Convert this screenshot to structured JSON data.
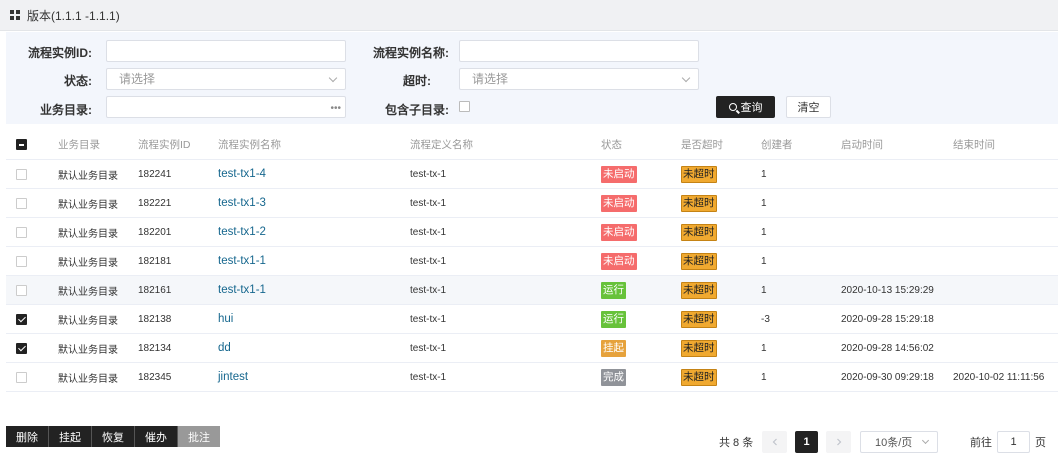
{
  "title": "版本(1.1.1 -1.1.1)",
  "filters": {
    "instance_id_label": "流程实例ID:",
    "instance_name_label": "流程实例名称:",
    "status_label": "状态:",
    "status_placeholder": "请选择",
    "timeout_label": "超时:",
    "timeout_placeholder": "请选择",
    "catalog_label": "业务目录:",
    "include_sub_label": "包含子目录:",
    "query_label": "查询",
    "clear_label": "清空"
  },
  "table": {
    "columns": [
      "业务目录",
      "流程实例ID",
      "流程实例名称",
      "流程定义名称",
      "状态",
      "是否超时",
      "创建者",
      "启动时间",
      "结束时间"
    ],
    "rows": [
      {
        "catalog": "默认业务目录",
        "id": "182241",
        "name": "test-tx1-4",
        "def": "test-tx-1",
        "status": "未启动",
        "status_color": "red",
        "timeout": "未超时",
        "creator": "1",
        "start": "",
        "end": "",
        "checked": false
      },
      {
        "catalog": "默认业务目录",
        "id": "182221",
        "name": "test-tx1-3",
        "def": "test-tx-1",
        "status": "未启动",
        "status_color": "red",
        "timeout": "未超时",
        "creator": "1",
        "start": "",
        "end": "",
        "checked": false
      },
      {
        "catalog": "默认业务目录",
        "id": "182201",
        "name": "test-tx1-2",
        "def": "test-tx-1",
        "status": "未启动",
        "status_color": "red",
        "timeout": "未超时",
        "creator": "1",
        "start": "",
        "end": "",
        "checked": false
      },
      {
        "catalog": "默认业务目录",
        "id": "182181",
        "name": "test-tx1-1",
        "def": "test-tx-1",
        "status": "未启动",
        "status_color": "red",
        "timeout": "未超时",
        "creator": "1",
        "start": "",
        "end": "",
        "checked": false
      },
      {
        "catalog": "默认业务目录",
        "id": "182161",
        "name": "test-tx1-1",
        "def": "test-tx-1",
        "status": "运行",
        "status_color": "green",
        "timeout": "未超时",
        "creator": "1",
        "start": "2020-10-13 15:29:29",
        "end": "",
        "checked": false
      },
      {
        "catalog": "默认业务目录",
        "id": "182138",
        "name": "hui",
        "def": "test-tx-1",
        "status": "运行",
        "status_color": "green",
        "timeout": "未超时",
        "creator": "-3",
        "start": "2020-09-28 15:29:18",
        "end": "",
        "checked": true
      },
      {
        "catalog": "默认业务目录",
        "id": "182134",
        "name": "dd",
        "def": "test-tx-1",
        "status": "挂起",
        "status_color": "orange",
        "timeout": "未超时",
        "creator": "1",
        "start": "2020-09-28 14:56:02",
        "end": "",
        "checked": true
      },
      {
        "catalog": "默认业务目录",
        "id": "182345",
        "name": "jintest",
        "def": "test-tx-1",
        "status": "完成",
        "status_color": "gray",
        "timeout": "未超时",
        "creator": "1",
        "start": "2020-09-30 09:29:18",
        "end": "2020-10-02 11:11:56",
        "checked": false
      }
    ]
  },
  "actions": [
    "删除",
    "挂起",
    "恢复",
    "催办",
    "批注"
  ],
  "pager": {
    "total": "共 8 条",
    "current": "1",
    "page_size": "10条/页",
    "goto_prefix": "前往",
    "goto_value": "1",
    "goto_suffix": "页"
  },
  "colors": {
    "red": "#f56c6c",
    "green": "#67c23a",
    "orange": "#e6a23c",
    "gray": "#909399",
    "link": "#16678e",
    "dark": "#222222"
  }
}
